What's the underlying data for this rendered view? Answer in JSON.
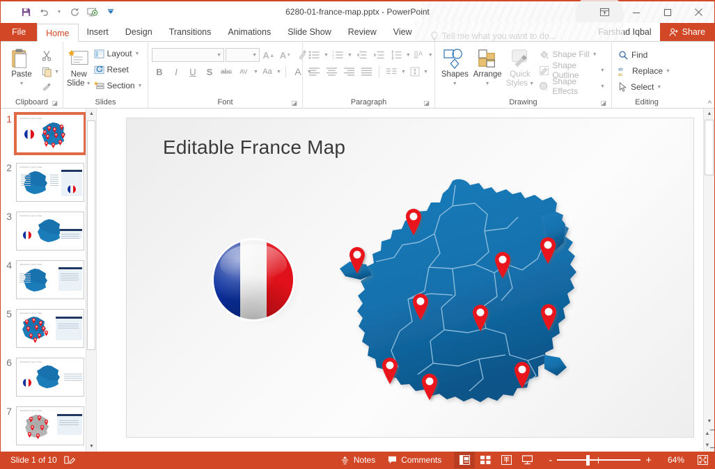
{
  "window": {
    "title": "6280-01-france-map.pptx - PowerPoint",
    "quick_access": [
      {
        "name": "save-icon",
        "label": "Save"
      },
      {
        "name": "undo-icon",
        "label": "Undo"
      },
      {
        "name": "redo-icon",
        "label": "Redo"
      },
      {
        "name": "start-presentation-icon",
        "label": "Start From Beginning"
      },
      {
        "name": "customize-qat-icon",
        "label": "Customize Quick Access Toolbar"
      }
    ],
    "controls": [
      {
        "name": "ribbon-display-options-icon",
        "label": "Ribbon Display Options"
      },
      {
        "name": "minimize-icon",
        "label": "Minimize"
      },
      {
        "name": "maximize-icon",
        "label": "Maximize"
      },
      {
        "name": "close-icon",
        "label": "Close"
      }
    ],
    "accent_color": "#d24726"
  },
  "ribbon": {
    "tabs": [
      {
        "label": "File",
        "active": false,
        "file": true
      },
      {
        "label": "Home",
        "active": true
      },
      {
        "label": "Insert",
        "active": false
      },
      {
        "label": "Design",
        "active": false
      },
      {
        "label": "Transitions",
        "active": false
      },
      {
        "label": "Animations",
        "active": false
      },
      {
        "label": "Slide Show",
        "active": false
      },
      {
        "label": "Review",
        "active": false
      },
      {
        "label": "View",
        "active": false
      }
    ],
    "tell_me": "Tell me what you want to do...",
    "user_name": "Farshad Iqbal",
    "share_label": "Share",
    "collapse_label": "Collapse the Ribbon",
    "groups": {
      "clipboard": {
        "label": "Clipboard",
        "paste": "Paste",
        "cut": "Cut",
        "copy": "Copy",
        "format_painter": "Format Painter"
      },
      "slides": {
        "label": "Slides",
        "new_slide": "New\nSlide",
        "new_slide_line1": "New",
        "new_slide_line2": "Slide",
        "layout": "Layout",
        "reset": "Reset",
        "section": "Section"
      },
      "font": {
        "label": "Font",
        "font_name_value": "",
        "font_name_placeholder": "",
        "font_size_value": "",
        "grow_font": "A",
        "shrink_font": "A",
        "clear_formatting": "Clear All Formatting",
        "bold": "B",
        "italic": "I",
        "underline": "U",
        "shadow": "S",
        "strikethrough": "abc",
        "character_spacing": "AV",
        "change_case": "Aa",
        "font_color": "A"
      },
      "paragraph": {
        "label": "Paragraph",
        "bullets": "Bullets",
        "numbering": "Numbering",
        "decrease_indent": "Decrease List Level",
        "increase_indent": "Increase List Level",
        "line_spacing": "Line Spacing",
        "text_direction": "Text Direction",
        "align_text": "Align Text",
        "convert_smartart": "Convert to SmartArt",
        "align_left": "Align Left",
        "center": "Center",
        "align_right": "Align Right",
        "justify": "Justify",
        "columns": "Columns"
      },
      "drawing": {
        "label": "Drawing",
        "shapes": "Shapes",
        "arrange": "Arrange",
        "quick_styles_line1": "Quick",
        "quick_styles_line2": "Styles",
        "shape_fill": "Shape Fill",
        "shape_outline": "Shape Outline",
        "shape_effects": "Shape Effects"
      },
      "editing": {
        "label": "Editing",
        "find": "Find",
        "replace": "Replace",
        "select": "Select"
      }
    }
  },
  "thumbnails": {
    "slides": [
      {
        "number": "1",
        "selected": true,
        "title": "Editable France Map",
        "layout": "map-flag-pins"
      },
      {
        "number": "2",
        "selected": false,
        "title": "Editable France Map",
        "layout": "map-labels-panel"
      },
      {
        "number": "3",
        "selected": false,
        "title": "Editable France Map",
        "layout": "map-flag-bar"
      },
      {
        "number": "4",
        "selected": false,
        "title": "Editable France Map",
        "layout": "map-callouts-panel"
      },
      {
        "number": "5",
        "selected": false,
        "title": "Editable France Map",
        "layout": "map-pins-panel"
      },
      {
        "number": "6",
        "selected": false,
        "title": "Editable France Map",
        "layout": "map-flag-text"
      },
      {
        "number": "7",
        "selected": false,
        "title": "Editable France Map",
        "layout": "map-gray-pins-panel"
      }
    ]
  },
  "slide": {
    "title": "Editable France Map",
    "flag": {
      "name": "france-flag-sphere",
      "colors": [
        "#0b2f9e",
        "#f2f2f2",
        "#e0111a"
      ]
    },
    "map": {
      "name": "france-map",
      "fill_top": "#1b7ab8",
      "fill_bottom": "#0d5a93",
      "border_color": "#9ec7e2",
      "pin_color": "#e8171f",
      "pin_count": 10
    }
  },
  "status_bar": {
    "slide_indicator": "Slide 1 of 10",
    "notes_label": "Notes",
    "comments_label": "Comments",
    "views": [
      {
        "name": "normal-view-button",
        "label": "Normal",
        "active": true
      },
      {
        "name": "slide-sorter-view-button",
        "label": "Slide Sorter",
        "active": false
      },
      {
        "name": "reading-view-button",
        "label": "Reading View",
        "active": false
      },
      {
        "name": "slide-show-button",
        "label": "Slide Show",
        "active": false
      }
    ],
    "zoom_out_label": "-",
    "zoom_in_label": "+",
    "zoom_value": "64%",
    "fit_label": "Fit slide to current window"
  }
}
